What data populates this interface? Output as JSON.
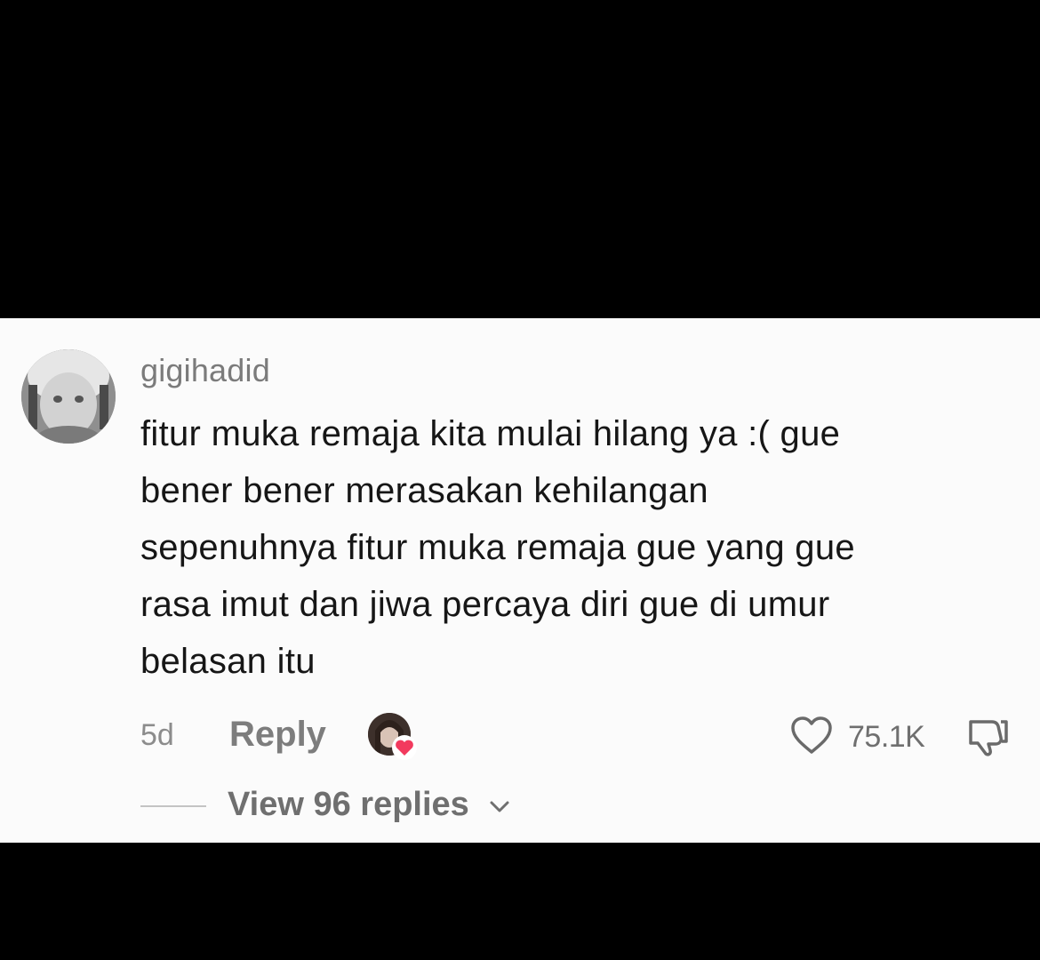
{
  "comment": {
    "username": "gigihadid",
    "avatar_icon": "user-avatar-photo",
    "text_lines": [
      "fitur muka remaja kita mulai hilang ya :( gue",
      "bener bener merasakan kehilangan",
      "sepenuhnya fitur muka remaja gue yang gue",
      "rasa imut dan jiwa percaya diri gue di umur",
      "belasan itu"
    ],
    "time": "5d",
    "reply_label": "Reply",
    "creator_liked_icon": "creator-heart-badge",
    "like_count": "75.1K",
    "like_icon": "heart-outline-icon",
    "dislike_icon": "thumbs-down-icon"
  },
  "replies": {
    "label": "View 96 replies",
    "chevron_icon": "chevron-down-icon"
  },
  "colors": {
    "card_background": "#fbfbfb",
    "backdrop": "#000000",
    "heart_badge": "#f23a5e"
  }
}
